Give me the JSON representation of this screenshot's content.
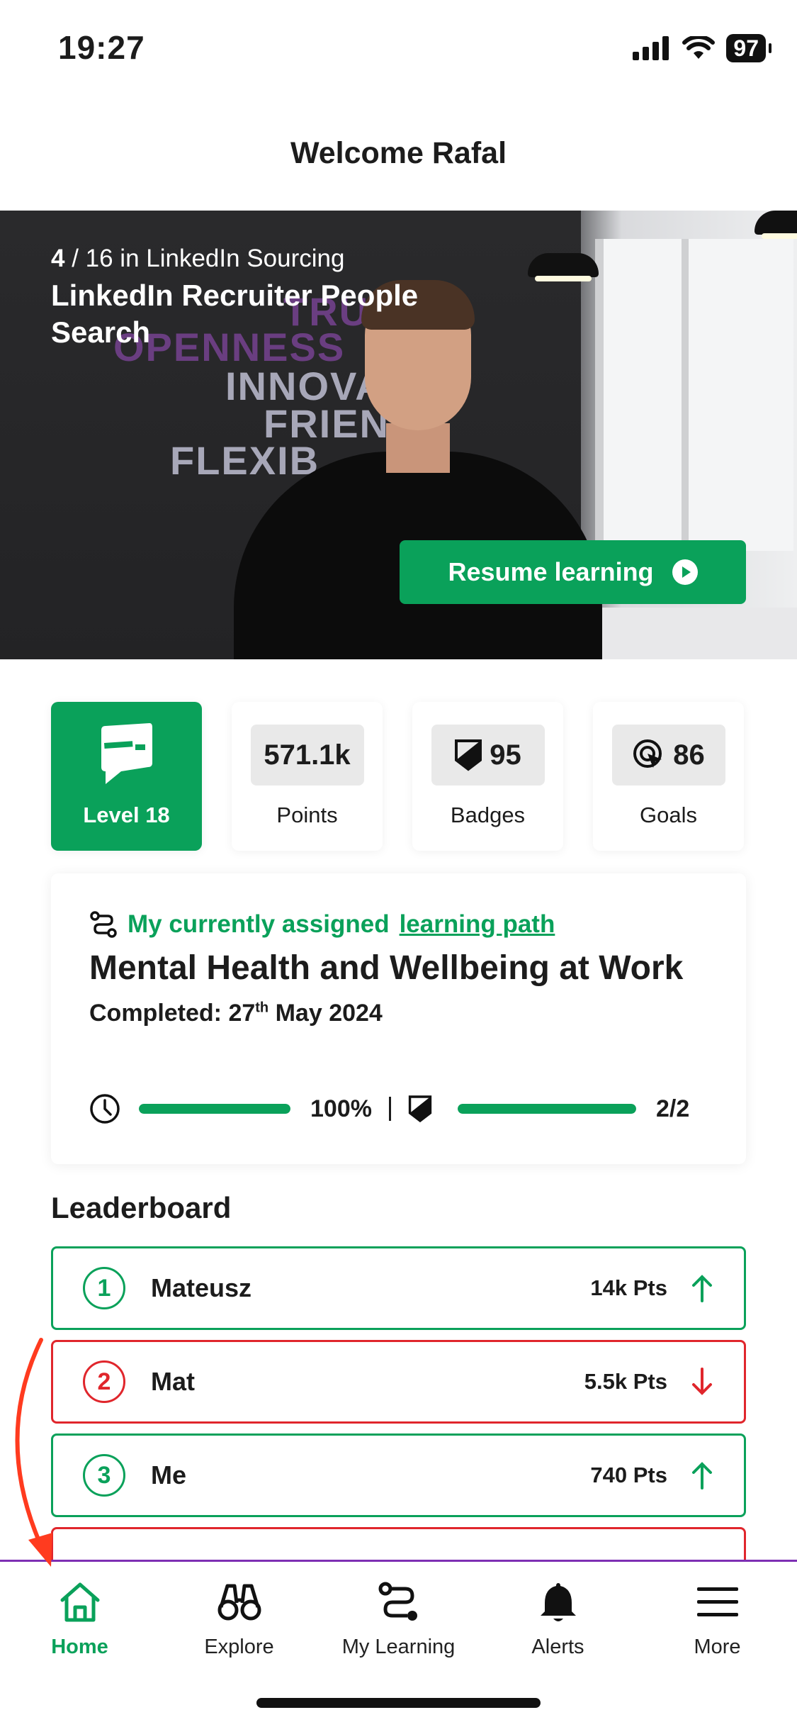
{
  "status_bar": {
    "time": "19:27",
    "battery": "97"
  },
  "header": {
    "title": "Welcome Rafal"
  },
  "hero": {
    "position": "4",
    "position_rest": " / 16 in LinkedIn Sourcing",
    "title": "LinkedIn Recruiter People Search",
    "resume_label": "Resume learning",
    "wall_words": [
      "TRUST",
      "OPENNESS",
      "INNOVAT",
      "FRIEN",
      "FLEXIB"
    ]
  },
  "stats": {
    "level_label": "Level 18",
    "points_value": "571.1k",
    "points_label": "Points",
    "badges_value": "95",
    "badges_label": "Badges",
    "goals_value": "86",
    "goals_label": "Goals"
  },
  "learning_path": {
    "heading_prefix": "My currently assigned",
    "heading_link": "learning path",
    "title": "Mental Health and Wellbeing at Work",
    "completed_prefix": "Completed: 27",
    "completed_sup": "th",
    "completed_suffix": " May 2024",
    "time_progress": 1.0,
    "time_progress_label": "100%",
    "badge_progress": 1.0,
    "badge_progress_label": "2/2"
  },
  "leaderboard": {
    "title": "Leaderboard",
    "rows": [
      {
        "rank": "1",
        "name": "Mateusz",
        "points": "14k Pts",
        "trend": "up"
      },
      {
        "rank": "2",
        "name": "Mat",
        "points": "5.5k Pts",
        "trend": "down"
      },
      {
        "rank": "3",
        "name": "Me",
        "points": "740 Pts",
        "trend": "up"
      }
    ]
  },
  "tabbar": {
    "items": [
      {
        "label": "Home",
        "icon": "home-icon",
        "active": true
      },
      {
        "label": "Explore",
        "icon": "binoculars-icon"
      },
      {
        "label": "My Learning",
        "icon": "path-icon"
      },
      {
        "label": "Alerts",
        "icon": "bell-icon"
      },
      {
        "label": "More",
        "icon": "menu-icon"
      }
    ]
  },
  "colors": {
    "brand_green": "#0aa15a",
    "down_red": "#e0262c",
    "tab_divider": "#7d2fb3",
    "annotation_arrow": "#ff3b1f"
  }
}
